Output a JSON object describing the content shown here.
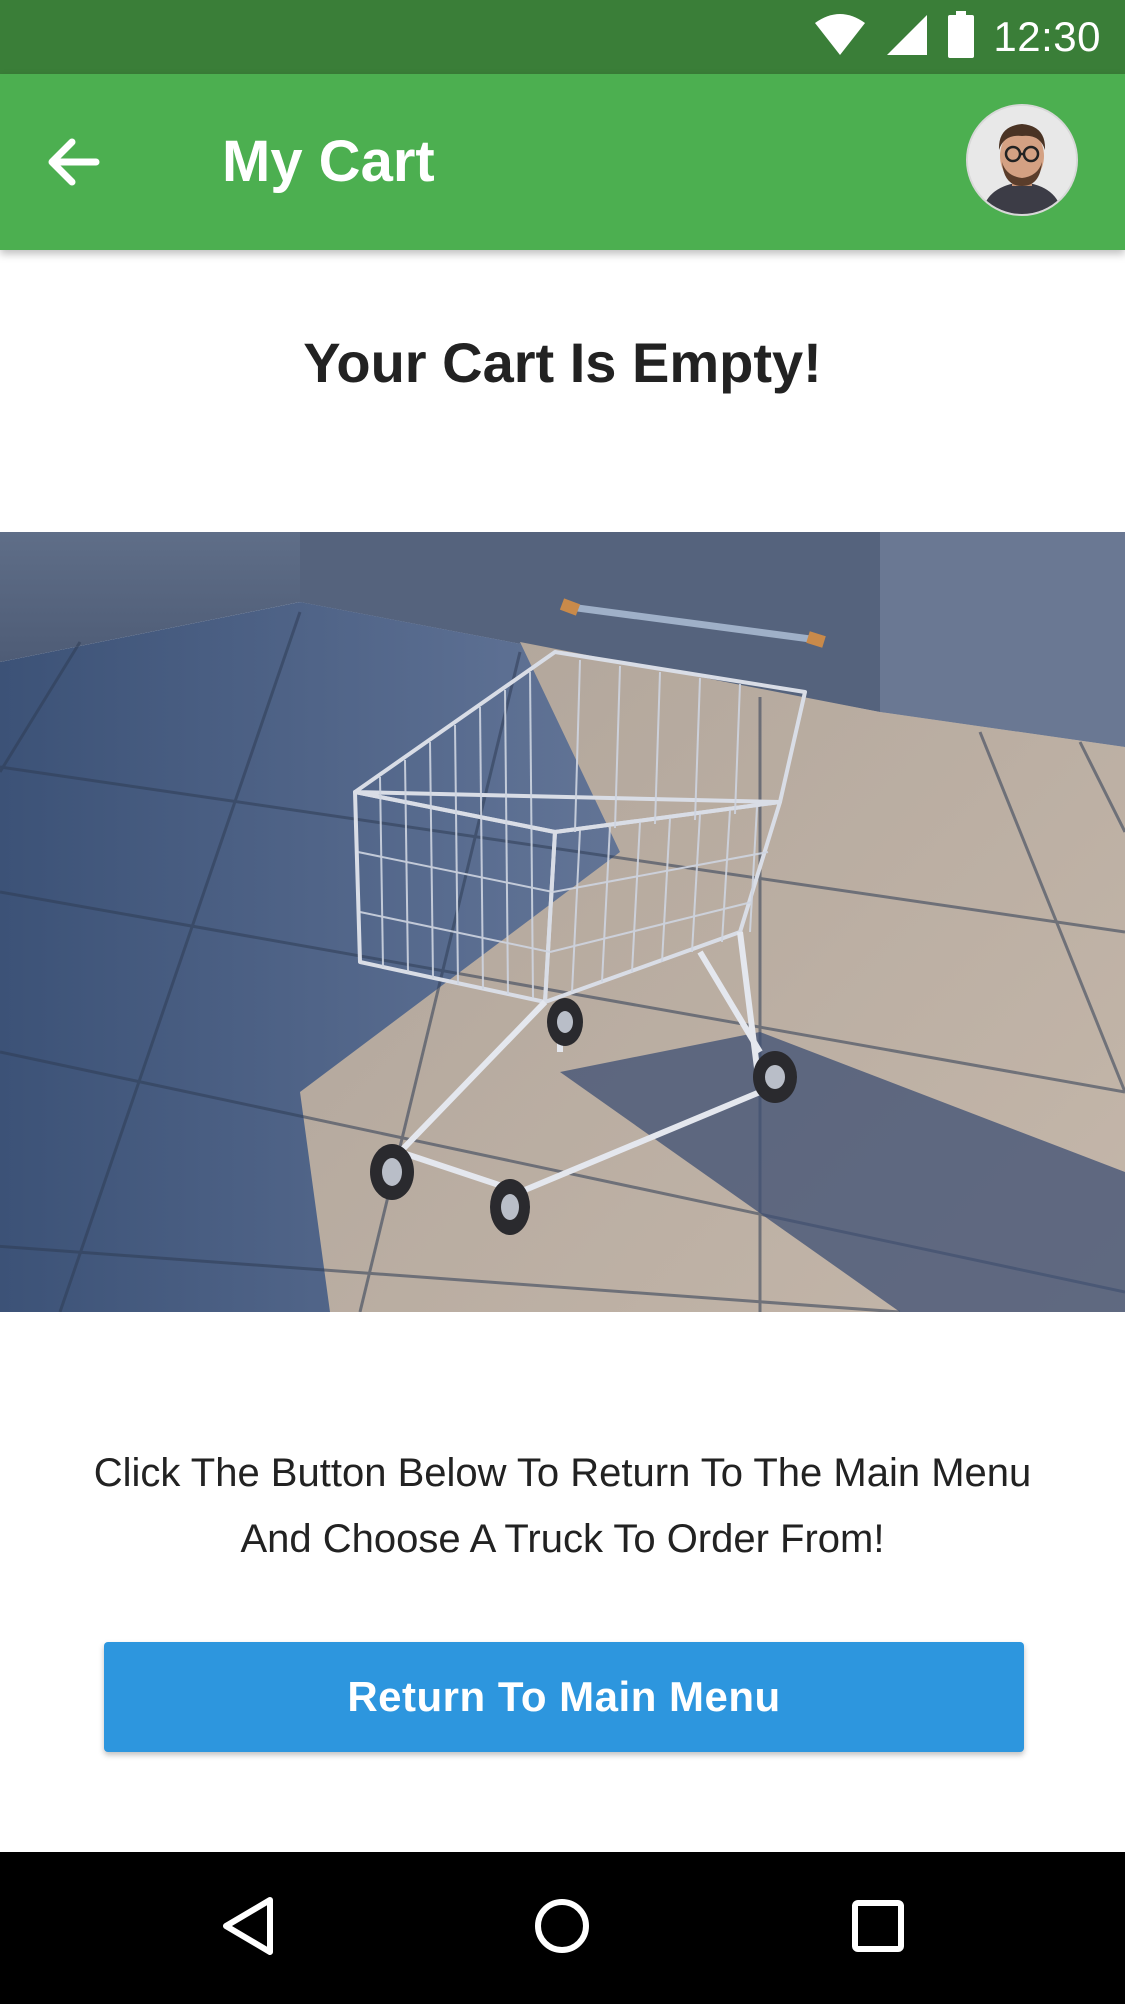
{
  "status_bar": {
    "time": "12:30",
    "icons": [
      "wifi-icon",
      "signal-icon",
      "battery-icon"
    ]
  },
  "app_bar": {
    "title": "My Cart",
    "back_icon": "arrow-back-icon",
    "avatar": "user-avatar"
  },
  "content": {
    "heading": "Your Cart Is Empty!",
    "image": "shopping-cart-photo",
    "message_line1": "Click The Button Below To Return To The Main Menu",
    "message_line2": "And Choose A Truck To Order From!",
    "button_label": "Return To Main Menu"
  },
  "nav_bar": {
    "icons": [
      "back-triangle-icon",
      "home-circle-icon",
      "recents-square-icon"
    ]
  },
  "colors": {
    "status_bar": "#3a7e38",
    "app_bar": "#4caf50",
    "button": "#2d96de",
    "nav_bar": "#000000"
  }
}
